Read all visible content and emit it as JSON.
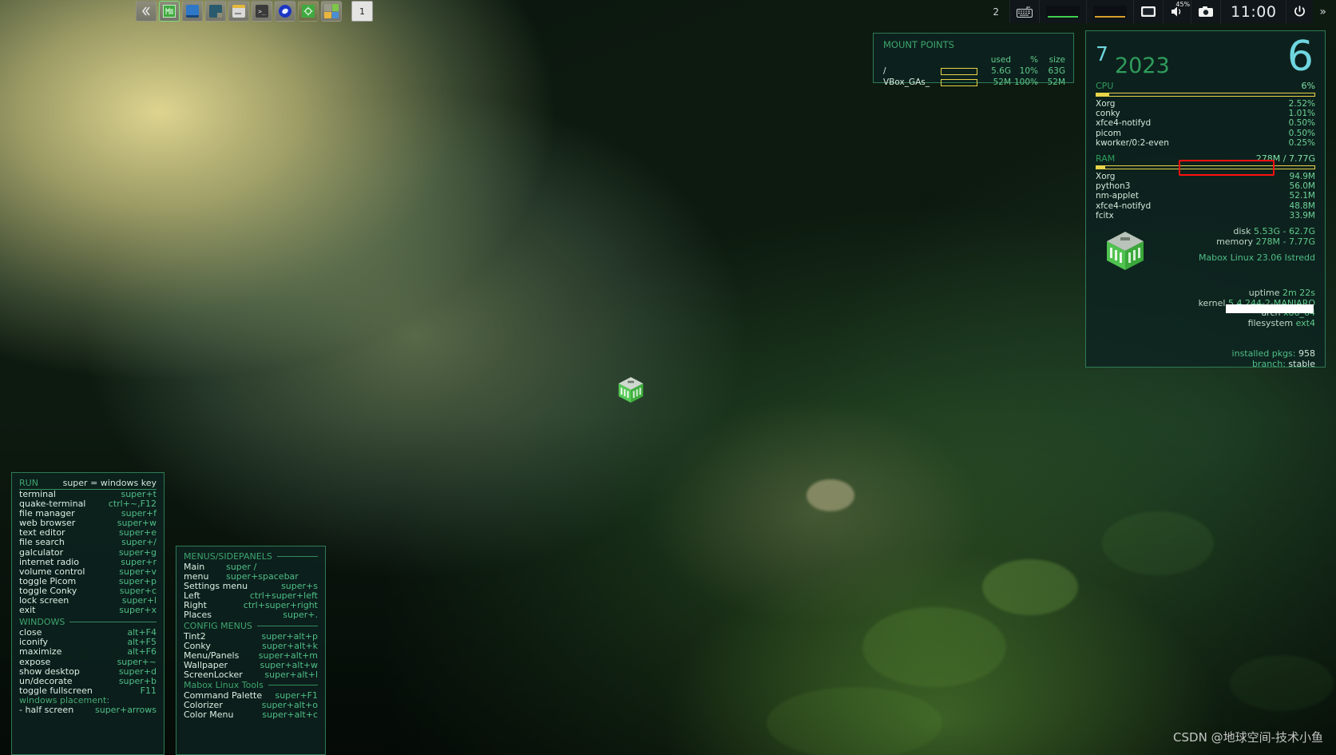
{
  "desktop": {
    "icon_label": "",
    "watermark": "CSDN @地球空间-技术小鱼"
  },
  "panel": {
    "collapse_icon": "chevron-left-double-icon",
    "launchers": [
      {
        "name": "mabox-menu-icon",
        "label": "M"
      },
      {
        "name": "file-manager-icon",
        "label": ""
      },
      {
        "name": "notes-icon",
        "label": ""
      },
      {
        "name": "archive-manager-icon",
        "label": ""
      },
      {
        "name": "terminal-icon",
        "label": ">_"
      },
      {
        "name": "web-browser-icon",
        "label": ""
      },
      {
        "name": "settings-icon",
        "label": ""
      },
      {
        "name": "colors-icon",
        "label": ""
      }
    ],
    "taskbar": [
      {
        "label": "1"
      }
    ],
    "tray": {
      "desktop_number": "2",
      "keyboard_icon": "keyboard-icon",
      "cpu_graph": "cpu-graph",
      "net_graph": "network-graph",
      "display_icon": "display-icon",
      "volume_icon": "volume-icon",
      "volume_level": "45%",
      "screenshot_icon": "camera-icon",
      "clock": "11:00",
      "power_icon": "power-icon",
      "overflow_icon": "chevron-right-double-icon"
    }
  },
  "mount_points": {
    "title": "MOUNT POINTS",
    "columns": [
      "",
      "",
      "used",
      "%",
      "size"
    ],
    "rows": [
      {
        "name": "/",
        "used": "5.6G",
        "percent": "10%",
        "size": "63G",
        "fill": 10
      },
      {
        "name": "VBox_GAs_",
        "used": "52M",
        "percent": "100%",
        "size": "52M",
        "fill": 100
      }
    ]
  },
  "system": {
    "date": {
      "day": "7",
      "year": "2023",
      "big": "6"
    },
    "cpu": {
      "label": "CPU",
      "value": "6%",
      "fill": 6,
      "processes": [
        {
          "name": "Xorg",
          "value": "2.52%"
        },
        {
          "name": "conky",
          "value": "1.01%"
        },
        {
          "name": "xfce4-notifyd",
          "value": "0.50%"
        },
        {
          "name": "picom",
          "value": "0.50%"
        },
        {
          "name": "kworker/0:2-even",
          "value": "0.25%"
        }
      ]
    },
    "ram": {
      "label": "RAM",
      "value": "278M / 7.77G",
      "fill": 4,
      "processes": [
        {
          "name": "Xorg",
          "value": "94.9M"
        },
        {
          "name": "python3",
          "value": "56.0M"
        },
        {
          "name": "nm-applet",
          "value": "52.1M"
        },
        {
          "name": "xfce4-notifyd",
          "value": "48.8M"
        },
        {
          "name": "fcitx",
          "value": "33.9M"
        }
      ]
    },
    "info": [
      {
        "key": "disk",
        "value": "5.53G - 62.7G"
      },
      {
        "key": "memory",
        "value": "278M - 7.77G"
      }
    ],
    "distro": "Mabox Linux 23.06 Istredd",
    "meta": [
      {
        "key": "uptime",
        "value": "2m 22s"
      },
      {
        "key": "kernel",
        "value": "5.4.244-2-MANJARO"
      },
      {
        "key": "arch",
        "value": "x86_64"
      },
      {
        "key": "filesystem",
        "value": "ext4"
      }
    ],
    "packages": {
      "key": "installed pkgs:",
      "value": "958"
    },
    "branch": {
      "key": "branch:",
      "value": "stable"
    },
    "highlight_color": "#ff1111"
  },
  "run_panel": {
    "title": "RUN",
    "subtitle": "super = windows key",
    "items": [
      {
        "name": "terminal",
        "key": "super+t"
      },
      {
        "name": "quake-terminal",
        "key": "ctrl+~,F12"
      },
      {
        "name": "file manager",
        "key": "super+f"
      },
      {
        "name": "web browser",
        "key": "super+w"
      },
      {
        "name": "text editor",
        "key": "super+e"
      },
      {
        "name": "file search",
        "key": "super+/"
      },
      {
        "name": "galculator",
        "key": "super+g"
      },
      {
        "name": "internet radio",
        "key": "super+r"
      },
      {
        "name": "volume control",
        "key": "super+v"
      },
      {
        "name": "toggle Picom",
        "key": "super+p"
      },
      {
        "name": "toggle Conky",
        "key": "super+c"
      },
      {
        "name": "lock screen",
        "key": "super+l"
      },
      {
        "name": "exit",
        "key": "super+x"
      }
    ],
    "windows_title": "WINDOWS",
    "windows_items": [
      {
        "name": "close",
        "key": "alt+F4"
      },
      {
        "name": "iconify",
        "key": "alt+F5"
      },
      {
        "name": "maximize",
        "key": "alt+F6"
      },
      {
        "name": "expose",
        "key": "super+~"
      },
      {
        "name": "show desktop",
        "key": "super+d"
      },
      {
        "name": "un/decorate",
        "key": "super+b"
      },
      {
        "name": "toggle fullscreen",
        "key": "F11"
      }
    ],
    "placement_note": "windows placement:",
    "placement_items": [
      {
        "name": " - half screen",
        "key": "super+arrows"
      }
    ]
  },
  "menus_panel": {
    "title": "MENUS/SIDEPANELS",
    "items": [
      {
        "name": "Main menu",
        "key": "super / super+spacebar"
      },
      {
        "name": "Settings menu",
        "key": "super+s"
      },
      {
        "name": "Left",
        "key": "ctrl+super+left"
      },
      {
        "name": "Right",
        "key": "ctrl+super+right"
      },
      {
        "name": "Places",
        "key": "super+."
      }
    ],
    "config_title": "CONFIG MENUS",
    "config_items": [
      {
        "name": "Tint2",
        "key": "super+alt+p"
      },
      {
        "name": "Conky",
        "key": "super+alt+k"
      },
      {
        "name": "Menu/Panels",
        "key": "super+alt+m"
      },
      {
        "name": "Wallpaper",
        "key": "super+alt+w"
      },
      {
        "name": "ScreenLocker",
        "key": "super+alt+l"
      }
    ],
    "tools_title": "Mabox Linux Tools",
    "tools_items": [
      {
        "name": "Command Palette",
        "key": "super+F1"
      },
      {
        "name": "Colorizer",
        "key": "super+alt+o"
      },
      {
        "name": "Color Menu",
        "key": "super+alt+c"
      }
    ]
  }
}
